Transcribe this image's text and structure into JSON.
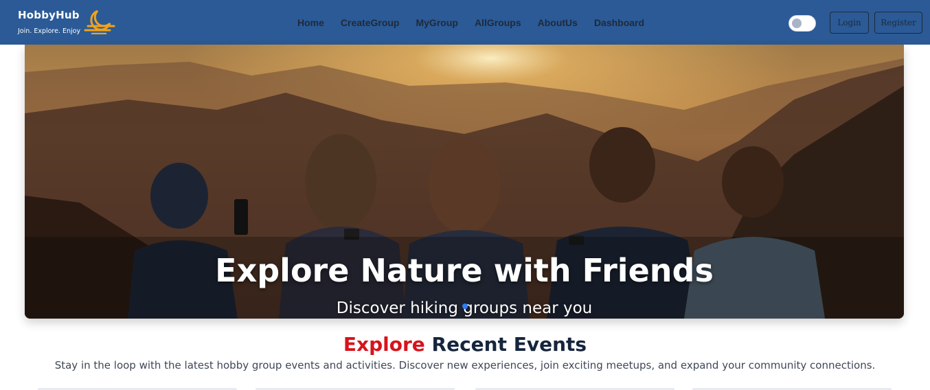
{
  "brand": {
    "name": "HobbyHub",
    "tagline": "Join. Explore. Enjoy",
    "logo_icon": "moon-sunset-logo-icon",
    "logo_color": "#f0a21c"
  },
  "nav": {
    "items": [
      {
        "label": "Home"
      },
      {
        "label": "CreateGroup"
      },
      {
        "label": "MyGroup"
      },
      {
        "label": "AllGroups"
      },
      {
        "label": "AboutUs"
      },
      {
        "label": "Dashboard"
      }
    ],
    "login_label": "Login",
    "register_label": "Register",
    "theme_toggle_icon": "theme-toggle-icon"
  },
  "hero": {
    "title": "Explore Nature with Friends",
    "subtitle": "Discover hiking groups near you"
  },
  "events": {
    "title_highlight": "Explore",
    "title_rest": "Recent Events",
    "description": "Stay in the loop with the latest hobby group events and activities. Discover new experiences, join exciting meetups, and expand your community connections."
  },
  "colors": {
    "navbar": "#2b5a96",
    "accent_red": "#d8131b",
    "heading_dark": "#16253d",
    "carousel_dot": "#2d7ef7"
  }
}
